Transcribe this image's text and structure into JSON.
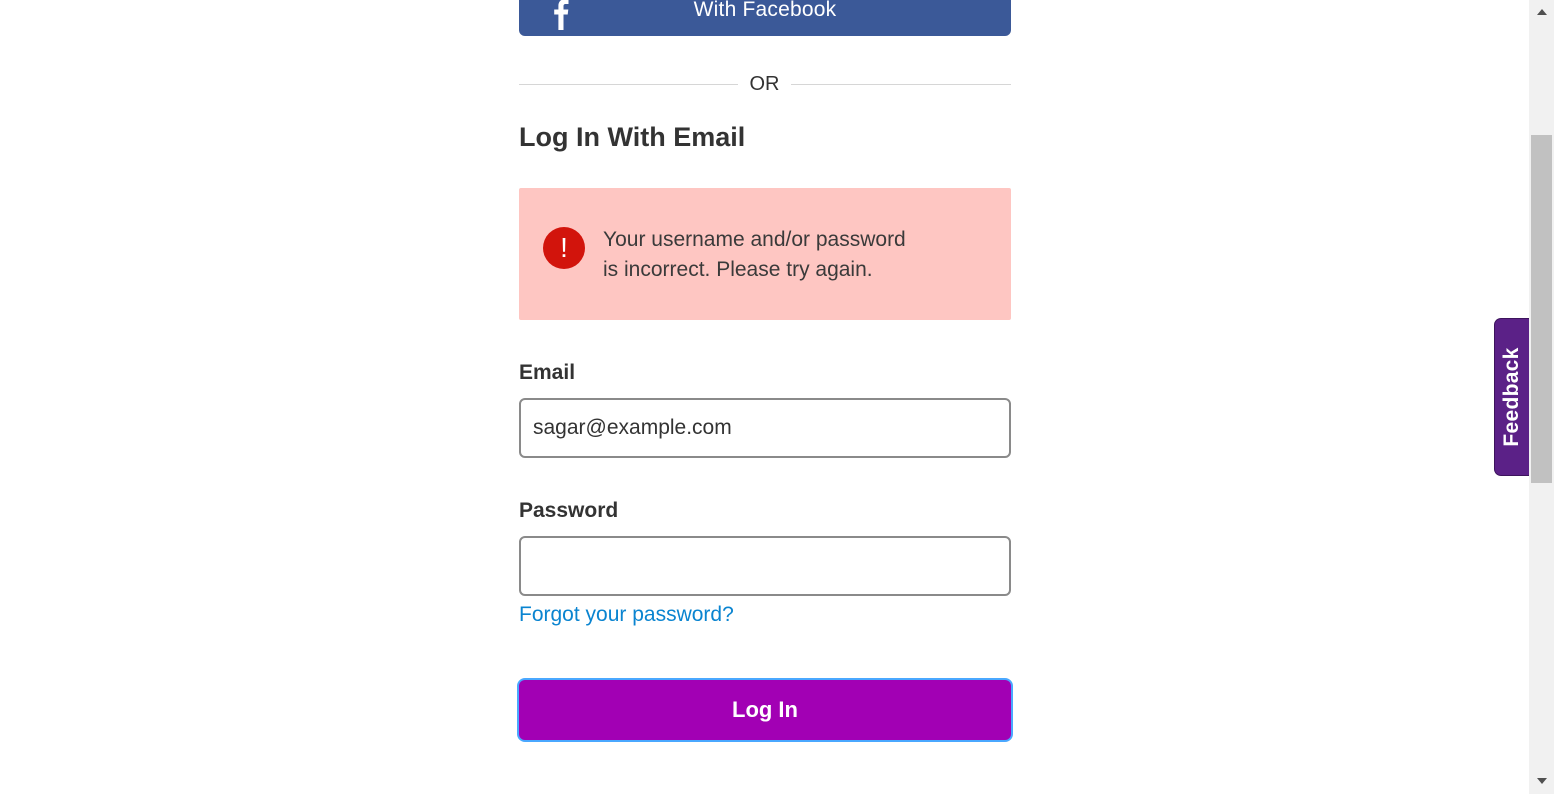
{
  "facebook": {
    "label": "With Facebook",
    "icon": "facebook-f-icon",
    "color": "#3b5998"
  },
  "divider": {
    "label": "OR"
  },
  "login": {
    "title": "Log In With Email",
    "error": {
      "icon": "exclamation-icon",
      "line1": "Your username and/or password",
      "line2": "is incorrect. Please try again.",
      "background": "#fec6c2",
      "icon_color": "#d2140c"
    },
    "email": {
      "label": "Email",
      "value": "sagar@example.com"
    },
    "password": {
      "label": "Password",
      "value": ""
    },
    "forgot_label": "Forgot your password?",
    "submit_label": "Log In",
    "submit_color": "#a200b4",
    "link_color": "#0a84d0"
  },
  "feedback": {
    "label": "Feedback",
    "color": "#5b2187"
  }
}
